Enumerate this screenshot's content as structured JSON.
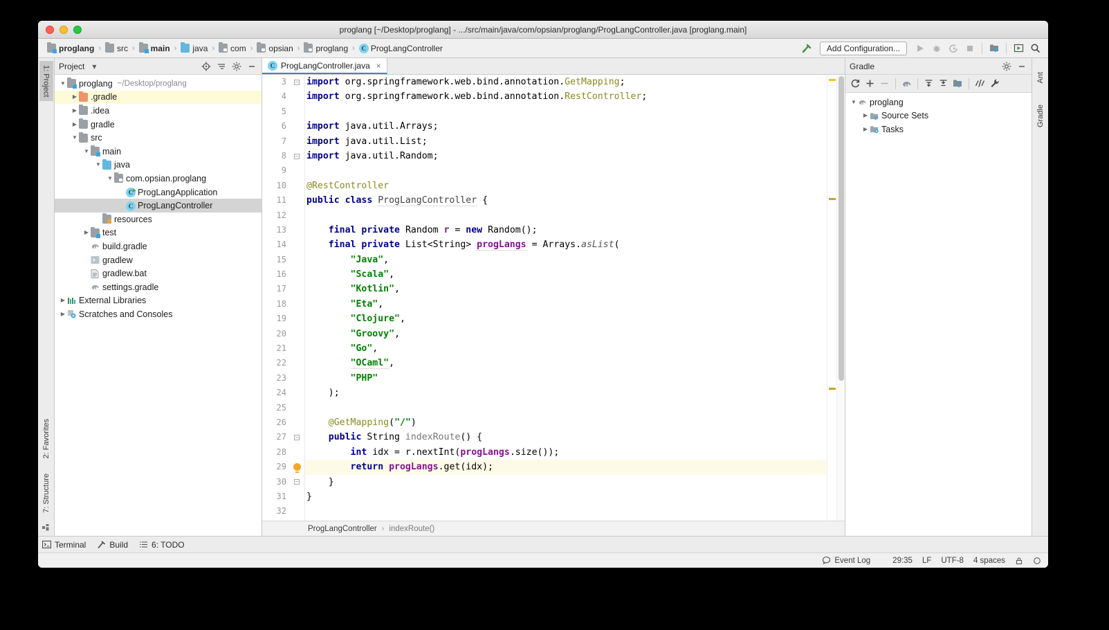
{
  "window": {
    "title": "proglang [~/Desktop/proglang] - .../src/main/java/com/opsian/proglang/ProgLangController.java [proglang.main]"
  },
  "breadcrumb": {
    "items": [
      {
        "label": "proglang",
        "icon": "module-folder-icon",
        "bold": true
      },
      {
        "label": "src",
        "icon": "folder-icon",
        "bold": false
      },
      {
        "label": "main",
        "icon": "module-folder-icon",
        "bold": true
      },
      {
        "label": "java",
        "icon": "source-root-folder-icon",
        "bold": false
      },
      {
        "label": "com",
        "icon": "package-folder-icon",
        "bold": false
      },
      {
        "label": "opsian",
        "icon": "package-folder-icon",
        "bold": false
      },
      {
        "label": "proglang",
        "icon": "package-folder-icon",
        "bold": false
      },
      {
        "label": "ProgLangController",
        "icon": "java-class-icon",
        "bold": false
      }
    ],
    "separator": "›"
  },
  "toolbar": {
    "build_hammer": "build-hammer-icon",
    "add_configuration": "Add Configuration...",
    "run": "run-icon",
    "debug": "debug-icon",
    "run_coverage": "run-with-coverage-icon",
    "stop": "stop-icon",
    "project_structure": "project-structure-icon",
    "updates": "updates-icon",
    "search": "search-everywhere-icon"
  },
  "left_rail": {
    "tabs": [
      {
        "label": "1: Project",
        "active": true
      },
      {
        "label": "2: Favorites",
        "active": false
      },
      {
        "label": "7: Structure",
        "active": false
      }
    ]
  },
  "right_rail": {
    "tabs": [
      {
        "label": "Ant",
        "active": false
      },
      {
        "label": "Gradle",
        "active": false
      }
    ]
  },
  "project_panel": {
    "title": "Project",
    "dropdown": "chevron-down-icon",
    "actions": [
      "locate-icon",
      "collapse-all-icon",
      "settings-gear-icon",
      "hide-icon"
    ],
    "tree": [
      {
        "label": "proglang",
        "sub": "~/Desktop/proglang",
        "depth": 0,
        "arrow": "down",
        "icon": "module-folder-icon",
        "state": "normal"
      },
      {
        "label": ".gradle",
        "sub": "",
        "depth": 1,
        "arrow": "right",
        "icon": "excluded-folder-icon",
        "state": "highlight"
      },
      {
        "label": ".idea",
        "sub": "",
        "depth": 1,
        "arrow": "right",
        "icon": "folder-icon",
        "state": "normal"
      },
      {
        "label": "gradle",
        "sub": "",
        "depth": 1,
        "arrow": "right",
        "icon": "folder-icon",
        "state": "normal"
      },
      {
        "label": "src",
        "sub": "",
        "depth": 1,
        "arrow": "down",
        "icon": "folder-icon",
        "state": "normal"
      },
      {
        "label": "main",
        "sub": "",
        "depth": 2,
        "arrow": "down",
        "icon": "module-folder-icon",
        "state": "normal"
      },
      {
        "label": "java",
        "sub": "",
        "depth": 3,
        "arrow": "down",
        "icon": "source-root-folder-icon",
        "state": "normal"
      },
      {
        "label": "com.opsian.proglang",
        "sub": "",
        "depth": 4,
        "arrow": "down",
        "icon": "package-folder-icon",
        "state": "normal"
      },
      {
        "label": "ProgLangApplication",
        "sub": "",
        "depth": 5,
        "arrow": "none",
        "icon": "java-runnable-class-icon",
        "state": "normal"
      },
      {
        "label": "ProgLangController",
        "sub": "",
        "depth": 5,
        "arrow": "none",
        "icon": "java-class-icon",
        "state": "selected"
      },
      {
        "label": "resources",
        "sub": "",
        "depth": 3,
        "arrow": "none",
        "icon": "resource-root-folder-icon",
        "state": "normal"
      },
      {
        "label": "test",
        "sub": "",
        "depth": 2,
        "arrow": "right",
        "icon": "module-folder-icon",
        "state": "normal"
      },
      {
        "label": "build.gradle",
        "sub": "",
        "depth": 2,
        "arrow": "none",
        "icon": "gradle-file-icon",
        "state": "normal"
      },
      {
        "label": "gradlew",
        "sub": "",
        "depth": 2,
        "arrow": "none",
        "icon": "shell-script-icon",
        "state": "normal"
      },
      {
        "label": "gradlew.bat",
        "sub": "",
        "depth": 2,
        "arrow": "none",
        "icon": "batch-file-icon",
        "state": "normal"
      },
      {
        "label": "settings.gradle",
        "sub": "",
        "depth": 2,
        "arrow": "none",
        "icon": "gradle-file-icon",
        "state": "normal"
      },
      {
        "label": "External Libraries",
        "sub": "",
        "depth": 0,
        "arrow": "right",
        "icon": "libraries-icon",
        "state": "normal"
      },
      {
        "label": "Scratches and Consoles",
        "sub": "",
        "depth": 0,
        "arrow": "right",
        "icon": "scratches-icon",
        "state": "normal"
      }
    ]
  },
  "editor": {
    "tab": {
      "label": "ProgLangController.java",
      "icon": "java-class-icon",
      "close": "×"
    },
    "first_line_number": 3,
    "current_line": 29,
    "lines": [
      {
        "n": 3,
        "fold": "minus-top",
        "tokens": [
          {
            "t": "import ",
            "c": "k"
          },
          {
            "t": "org.springframework.web.bind.annotation.",
            "c": "t"
          },
          {
            "t": "GetMapping",
            "c": "cn"
          },
          {
            "t": ";",
            "c": "t"
          }
        ]
      },
      {
        "n": 4,
        "fold": "",
        "tokens": [
          {
            "t": "import ",
            "c": "k"
          },
          {
            "t": "org.springframework.web.bind.annotation.",
            "c": "t"
          },
          {
            "t": "RestController",
            "c": "cn"
          },
          {
            "t": ";",
            "c": "t"
          }
        ]
      },
      {
        "n": 5,
        "fold": "",
        "tokens": []
      },
      {
        "n": 6,
        "fold": "",
        "tokens": [
          {
            "t": "import ",
            "c": "k"
          },
          {
            "t": "java.util.Arrays;",
            "c": "t"
          }
        ]
      },
      {
        "n": 7,
        "fold": "",
        "tokens": [
          {
            "t": "import ",
            "c": "k"
          },
          {
            "t": "java.util.List;",
            "c": "t"
          }
        ]
      },
      {
        "n": 8,
        "fold": "minus-bottom",
        "tokens": [
          {
            "t": "import ",
            "c": "k"
          },
          {
            "t": "java.util.Random;",
            "c": "t"
          }
        ]
      },
      {
        "n": 9,
        "fold": "",
        "tokens": []
      },
      {
        "n": 10,
        "fold": "",
        "tokens": [
          {
            "t": "@RestController",
            "c": "cn"
          }
        ]
      },
      {
        "n": 11,
        "fold": "",
        "tokens": [
          {
            "t": "public ",
            "c": "k"
          },
          {
            "t": "class ",
            "c": "k"
          },
          {
            "t": "ProgLangController",
            "c": "ty sq"
          },
          {
            "t": " {",
            "c": "t"
          }
        ]
      },
      {
        "n": 12,
        "fold": "",
        "tokens": []
      },
      {
        "n": 13,
        "fold": "",
        "tokens": [
          {
            "t": "    ",
            "c": "t"
          },
          {
            "t": "final ",
            "c": "k"
          },
          {
            "t": "private ",
            "c": "k"
          },
          {
            "t": "Random ",
            "c": "t"
          },
          {
            "t": "r",
            "c": "f"
          },
          {
            "t": " = ",
            "c": "t"
          },
          {
            "t": "new ",
            "c": "k"
          },
          {
            "t": "Random();",
            "c": "t"
          }
        ]
      },
      {
        "n": 14,
        "fold": "",
        "tokens": [
          {
            "t": "    ",
            "c": "t"
          },
          {
            "t": "final ",
            "c": "k"
          },
          {
            "t": "private ",
            "c": "k"
          },
          {
            "t": "List<String> ",
            "c": "t"
          },
          {
            "t": "progLangs",
            "c": "f sq"
          },
          {
            "t": " = Arrays.",
            "c": "t"
          },
          {
            "t": "asList",
            "c": "m"
          },
          {
            "t": "(",
            "c": "t"
          }
        ]
      },
      {
        "n": 15,
        "fold": "",
        "tokens": [
          {
            "t": "        ",
            "c": "t"
          },
          {
            "t": "\"Java\"",
            "c": "s"
          },
          {
            "t": ",",
            "c": "t"
          }
        ]
      },
      {
        "n": 16,
        "fold": "",
        "tokens": [
          {
            "t": "        ",
            "c": "t"
          },
          {
            "t": "\"Scala\"",
            "c": "s"
          },
          {
            "t": ",",
            "c": "t"
          }
        ]
      },
      {
        "n": 17,
        "fold": "",
        "tokens": [
          {
            "t": "        ",
            "c": "t"
          },
          {
            "t": "\"Kotlin\"",
            "c": "s"
          },
          {
            "t": ",",
            "c": "t"
          }
        ]
      },
      {
        "n": 18,
        "fold": "",
        "tokens": [
          {
            "t": "        ",
            "c": "t"
          },
          {
            "t": "\"Eta\"",
            "c": "s"
          },
          {
            "t": ",",
            "c": "t"
          }
        ]
      },
      {
        "n": 19,
        "fold": "",
        "tokens": [
          {
            "t": "        ",
            "c": "t"
          },
          {
            "t": "\"Clojure\"",
            "c": "s"
          },
          {
            "t": ",",
            "c": "t"
          }
        ]
      },
      {
        "n": 20,
        "fold": "",
        "tokens": [
          {
            "t": "        ",
            "c": "t"
          },
          {
            "t": "\"Groovy\"",
            "c": "s"
          },
          {
            "t": ",",
            "c": "t"
          }
        ]
      },
      {
        "n": 21,
        "fold": "",
        "tokens": [
          {
            "t": "        ",
            "c": "t"
          },
          {
            "t": "\"Go\"",
            "c": "s"
          },
          {
            "t": ",",
            "c": "t"
          }
        ]
      },
      {
        "n": 22,
        "fold": "",
        "tokens": [
          {
            "t": "        ",
            "c": "t"
          },
          {
            "t": "\"OCaml\"",
            "c": "s sq"
          },
          {
            "t": ",",
            "c": "t"
          }
        ]
      },
      {
        "n": 23,
        "fold": "",
        "tokens": [
          {
            "t": "        ",
            "c": "t"
          },
          {
            "t": "\"PHP\"",
            "c": "s"
          }
        ]
      },
      {
        "n": 24,
        "fold": "",
        "tokens": [
          {
            "t": "    );",
            "c": "t"
          }
        ]
      },
      {
        "n": 25,
        "fold": "",
        "tokens": []
      },
      {
        "n": 26,
        "fold": "",
        "tokens": [
          {
            "t": "    ",
            "c": "t"
          },
          {
            "t": "@GetMapping",
            "c": "cn"
          },
          {
            "t": "(",
            "c": "t"
          },
          {
            "t": "\"/\"",
            "c": "s"
          },
          {
            "t": ")",
            "c": "t"
          }
        ]
      },
      {
        "n": 27,
        "fold": "minus-top",
        "tokens": [
          {
            "t": "    ",
            "c": "t"
          },
          {
            "t": "public ",
            "c": "k"
          },
          {
            "t": "String ",
            "c": "t"
          },
          {
            "t": "indexRoute",
            "c": "mn"
          },
          {
            "t": "() {",
            "c": "t"
          }
        ]
      },
      {
        "n": 28,
        "fold": "",
        "tokens": [
          {
            "t": "        ",
            "c": "t"
          },
          {
            "t": "int ",
            "c": "k"
          },
          {
            "t": "idx = r.nextInt(",
            "c": "t"
          },
          {
            "t": "progLangs",
            "c": "f"
          },
          {
            "t": ".size());",
            "c": "t"
          }
        ]
      },
      {
        "n": 29,
        "fold": "",
        "bulb": true,
        "tokens": [
          {
            "t": "        ",
            "c": "t"
          },
          {
            "t": "return ",
            "c": "k"
          },
          {
            "t": "progLangs",
            "c": "f"
          },
          {
            "t": ".get(idx);",
            "c": "t"
          }
        ]
      },
      {
        "n": 30,
        "fold": "minus-bottom",
        "tokens": [
          {
            "t": "    }",
            "c": "t"
          }
        ]
      },
      {
        "n": 31,
        "fold": "",
        "tokens": [
          {
            "t": "}",
            "c": "t"
          }
        ]
      },
      {
        "n": 32,
        "fold": "",
        "tokens": []
      }
    ],
    "breadcrumb_footer": {
      "class": "ProgLangController",
      "member": "indexRoute()",
      "separator": "›"
    }
  },
  "gradle_panel": {
    "title": "Gradle",
    "actions": [
      "settings-gear-icon",
      "hide-icon"
    ],
    "toolbar": [
      "refresh-icon",
      "add-icon",
      "remove-icon",
      "gradle-elephant-icon",
      "expand-all-icon",
      "collapse-all-icon",
      "source-sets-icon",
      "toggle-offline-icon",
      "wrench-icon"
    ],
    "tree": [
      {
        "label": "proglang",
        "depth": 0,
        "arrow": "down",
        "icon": "gradle-elephant-icon"
      },
      {
        "label": "Source Sets",
        "depth": 1,
        "arrow": "right",
        "icon": "source-sets-icon"
      },
      {
        "label": "Tasks",
        "depth": 1,
        "arrow": "right",
        "icon": "tasks-icon"
      }
    ]
  },
  "bottom_toolbar": {
    "items": [
      {
        "label": "Terminal",
        "icon": "terminal-icon"
      },
      {
        "label": "Build",
        "icon": "build-hammer-icon"
      },
      {
        "label": "6: TODO",
        "icon": "todo-icon"
      }
    ]
  },
  "status_bar": {
    "event_log": "Event Log",
    "event_log_icon": "balloon-icon",
    "caret_position": "29:35",
    "line_separator": "LF",
    "encoding": "UTF-8",
    "indent": "4 spaces",
    "lock_icon": "read-only-lock-icon",
    "inspection_icon": "inspections-icon"
  },
  "colors": {
    "accent_blue": "#4184c4",
    "keyword": "#00008f",
    "string": "#008000",
    "field": "#871094",
    "annotation": "#8a8a1f",
    "current_line": "#fdfbe8",
    "selection": "#d4d4d4"
  }
}
